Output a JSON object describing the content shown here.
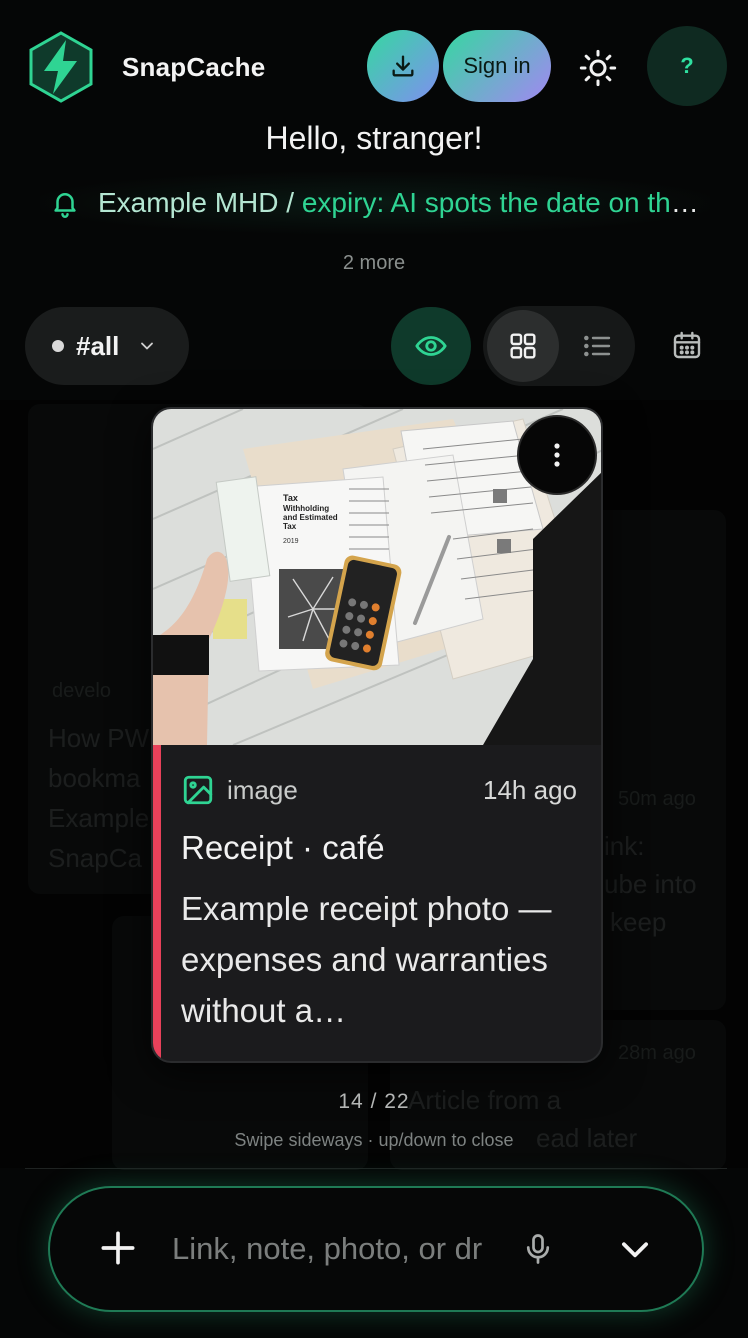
{
  "app": {
    "name": "SnapCache"
  },
  "header": {
    "download_icon": "download-icon",
    "sign_in_label": "Sign in",
    "theme_icon": "sun-icon",
    "help_label": "?"
  },
  "greeting": "Hello, stranger!",
  "notice": {
    "icon": "bell-icon",
    "title": "Example MHD",
    "separator": "/",
    "message": "expiry: AI spots the date on the label",
    "more": "2 more"
  },
  "toolbar": {
    "filter_tag": "#all",
    "views": [
      "grid",
      "list"
    ],
    "active_view": "grid"
  },
  "background_cards": [
    {
      "source": "develo",
      "text": [
        "How PW",
        "bookma",
        "Example",
        "SnapCa"
      ]
    },
    {
      "time": "50m ago",
      "text": [
        "ink:",
        "ube into",
        "keep"
      ]
    },
    {
      "time": "28m ago",
      "text": [
        "Article from a",
        "ead later"
      ]
    }
  ],
  "card": {
    "type": "image",
    "time": "14h ago",
    "title": "Receipt · café",
    "description": "Example receipt photo — expenses and warranties without a…",
    "accent_color": "#e8415a",
    "image_alt": "Tax documents and calculator on a white desk"
  },
  "pager": {
    "current": "14 / 22",
    "hint": "Swipe sideways · up/down to close"
  },
  "composer": {
    "placeholder": "Link, note, photo, or drop a file"
  },
  "colors": {
    "accent": "#2fd493",
    "background": "#050606"
  }
}
